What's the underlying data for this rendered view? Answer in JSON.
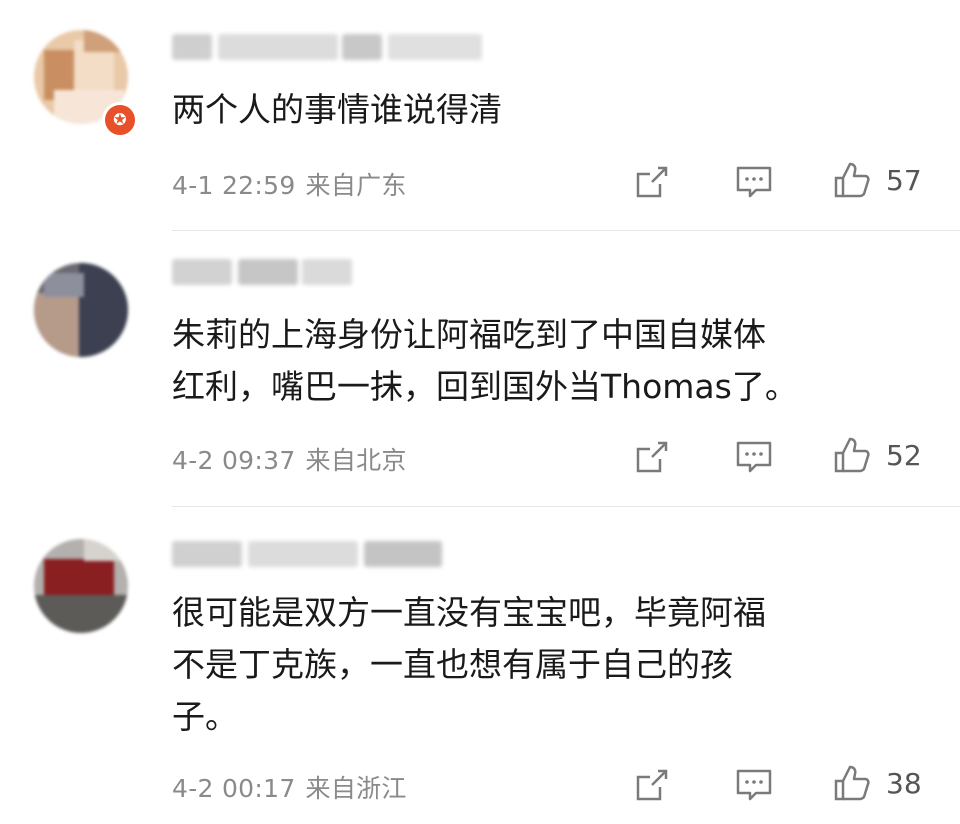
{
  "comments": [
    {
      "text": "两个人的事情谁说得清",
      "date": "4-1 22:59",
      "location": "来自广东",
      "likes": "57",
      "has_badge": true
    },
    {
      "text": "朱莉的上海身份让阿福吃到了中国自媒体\n红利，嘴巴一抹，回到国外当Thomas了。",
      "date": "4-2 09:37",
      "location": "来自北京",
      "likes": "52",
      "has_badge": false
    },
    {
      "text": "很可能是双方一直没有宝宝吧，毕竟阿福\n不是丁克族，一直也想有属于自己的孩\n子。",
      "date": "4-2 00:17",
      "location": "来自浙江",
      "likes": "38",
      "has_badge": false
    }
  ],
  "icons": {
    "share": "share-icon",
    "comment": "comment-icon",
    "like": "thumbs-up-icon"
  },
  "colors": {
    "meta_text": "#8a8a8a",
    "badge": "#e8502a",
    "icon_stroke": "#7a7a7a"
  }
}
